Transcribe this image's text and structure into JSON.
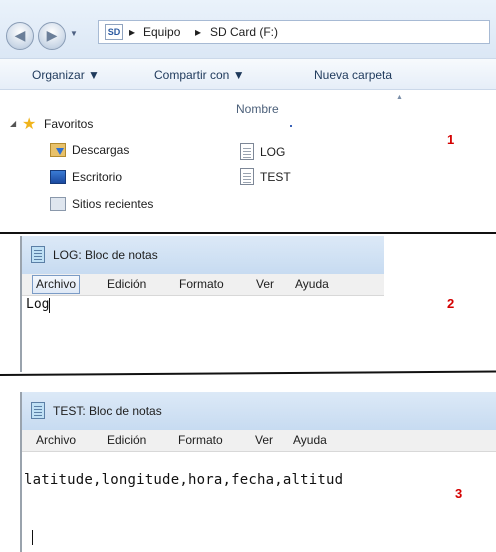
{
  "explorer": {
    "nav": {
      "back_icon": "back-arrow-icon",
      "forward_icon": "forward-arrow-icon"
    },
    "address": {
      "drive_icon_label": "SD",
      "crumbs": [
        "Equipo",
        "SD Card (F:)"
      ],
      "separator": "▸"
    },
    "toolbar": {
      "organize": "Organizar ▼",
      "share": "Compartir con ▼",
      "new_folder": "Nueva carpeta"
    },
    "favorites": {
      "header": "Favoritos",
      "items": [
        "Descargas",
        "Escritorio",
        "Sitios recientes"
      ]
    },
    "files": {
      "column_header": "Nombre",
      "items": [
        "LOG",
        "TEST"
      ]
    },
    "marker": "1"
  },
  "notepad_log": {
    "title": "LOG: Bloc de notas",
    "menu": [
      "Archivo",
      "Edición",
      "Formato",
      "Ver",
      "Ayuda"
    ],
    "content": "Log",
    "marker": "2"
  },
  "notepad_test": {
    "title": "TEST: Bloc de notas",
    "menu": [
      "Archivo",
      "Edición",
      "Formato",
      "Ver",
      "Ayuda"
    ],
    "content": "latitude,longitude,hora,fecha,altitud",
    "marker": "3"
  },
  "colors": {
    "marker": "#d40000",
    "titlebar": "#c7dbf1"
  }
}
